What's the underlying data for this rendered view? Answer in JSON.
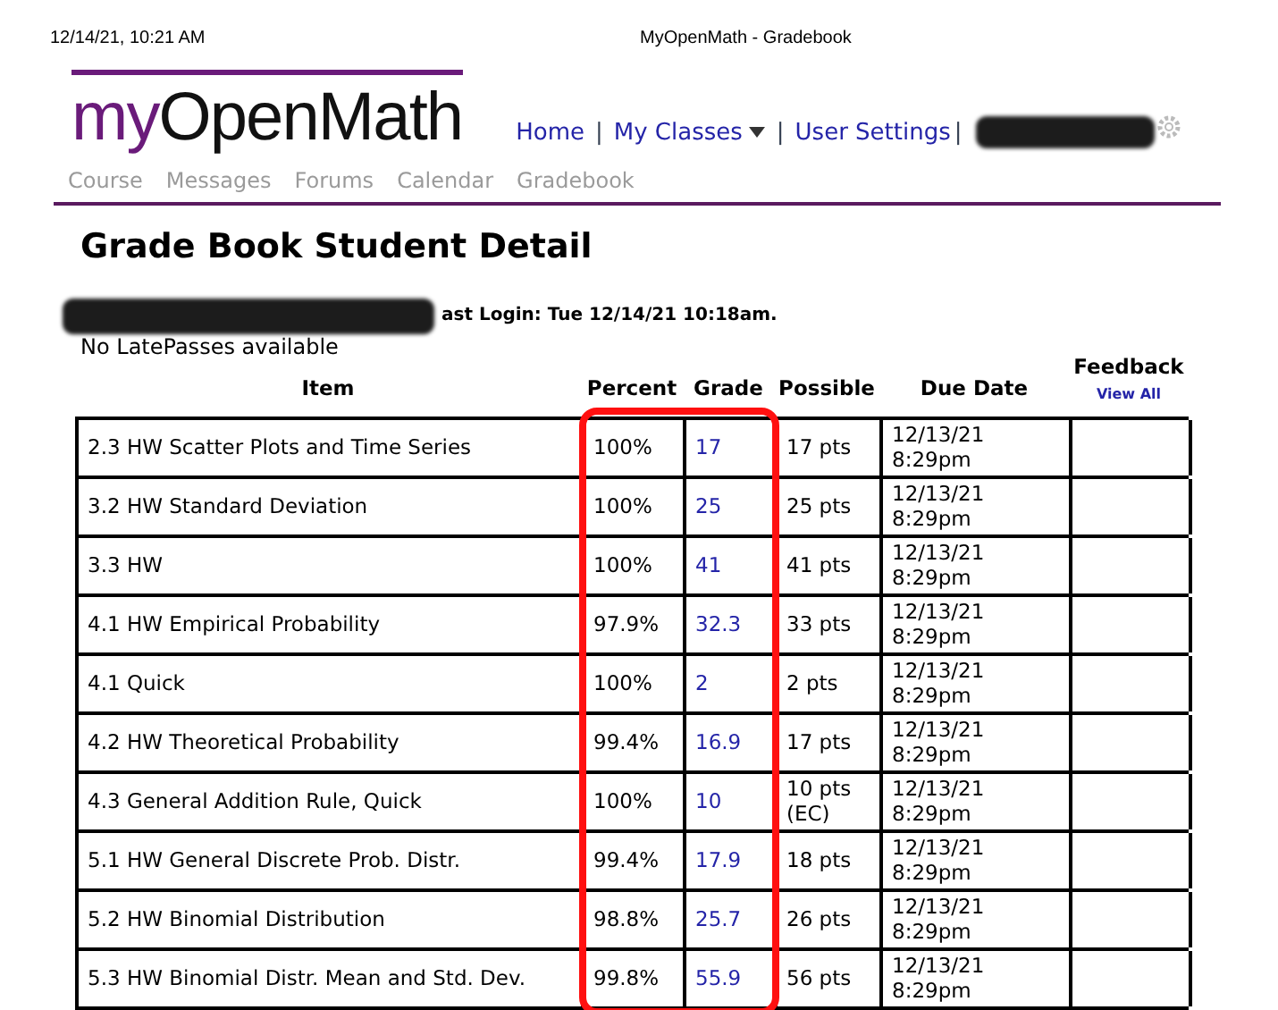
{
  "print_header": {
    "date": "12/14/21, 10:21 AM",
    "title": "MyOpenMath - Gradebook"
  },
  "logo": {
    "prefix": "my",
    "name": "OpenMath"
  },
  "top_nav": [
    {
      "label": "Home",
      "kind": "link",
      "separator": "|"
    },
    {
      "label": "My Classes",
      "kind": "dropdown",
      "separator": "|"
    },
    {
      "label": "User Settings",
      "kind": "link",
      "separator": "|"
    }
  ],
  "tabs": [
    {
      "label": "Course",
      "selected": false
    },
    {
      "label": "Messages",
      "selected": false
    },
    {
      "label": "Forums",
      "selected": false
    },
    {
      "label": "Calendar",
      "selected": false
    },
    {
      "label": "Gradebook",
      "selected": false
    }
  ],
  "heading": "Grade Book Student Detail",
  "last_login": "ast Login: Tue 12/14/21 10:18am.",
  "latepasses": "No LatePasses available",
  "table": {
    "columns": [
      {
        "label": "Item",
        "highlighted": false
      },
      {
        "label": "Percent",
        "highlighted": true
      },
      {
        "label": "Grade",
        "highlighted": true
      },
      {
        "label": "Possible",
        "highlighted": false
      },
      {
        "label": "Due Date",
        "highlighted": false
      },
      {
        "label": "Feedback",
        "highlighted": false,
        "link": "View All"
      }
    ],
    "rows": [
      {
        "item": "2.3 HW Scatter Plots and Time Series",
        "percent": "100%",
        "grade": "17",
        "possible": "17 pts",
        "due": "12/13/21 8:29pm"
      },
      {
        "item": "3.2 HW Standard Deviation",
        "percent": "100%",
        "grade": "25",
        "possible": "25 pts",
        "due": "12/13/21 8:29pm"
      },
      {
        "item": "3.3 HW",
        "percent": "100%",
        "grade": "41",
        "possible": "41 pts",
        "due": "12/13/21 8:29pm"
      },
      {
        "item": "4.1 HW Empirical Probability",
        "percent": "97.9%",
        "grade": "32.3",
        "possible": "33 pts",
        "due": "12/13/21 8:29pm"
      },
      {
        "item": "4.1 Quick",
        "percent": "100%",
        "grade": "2",
        "possible": "2 pts",
        "due": "12/13/21 8:29pm"
      },
      {
        "item": "4.2 HW Theoretical Probability",
        "percent": "99.4%",
        "grade": "16.9",
        "possible": "17 pts",
        "due": "12/13/21 8:29pm"
      },
      {
        "item": "4.3 General Addition Rule, Quick",
        "percent": "100%",
        "grade": "10",
        "possible": "10 pts (EC)",
        "due": "12/13/21 8:29pm"
      },
      {
        "item": "5.1 HW General Discrete Prob. Distr.",
        "percent": "99.4%",
        "grade": "17.9",
        "possible": "18 pts",
        "due": "12/13/21 8:29pm"
      },
      {
        "item": "5.2 HW Binomial Distribution",
        "percent": "98.8%",
        "grade": "25.7",
        "possible": "26 pts",
        "due": "12/13/21 8:29pm"
      },
      {
        "item": "5.3 HW Binomial Distr. Mean and Std. Dev.",
        "percent": "99.8%",
        "grade": "55.9",
        "possible": "56 pts",
        "due": "12/13/21 8:29pm"
      }
    ]
  }
}
